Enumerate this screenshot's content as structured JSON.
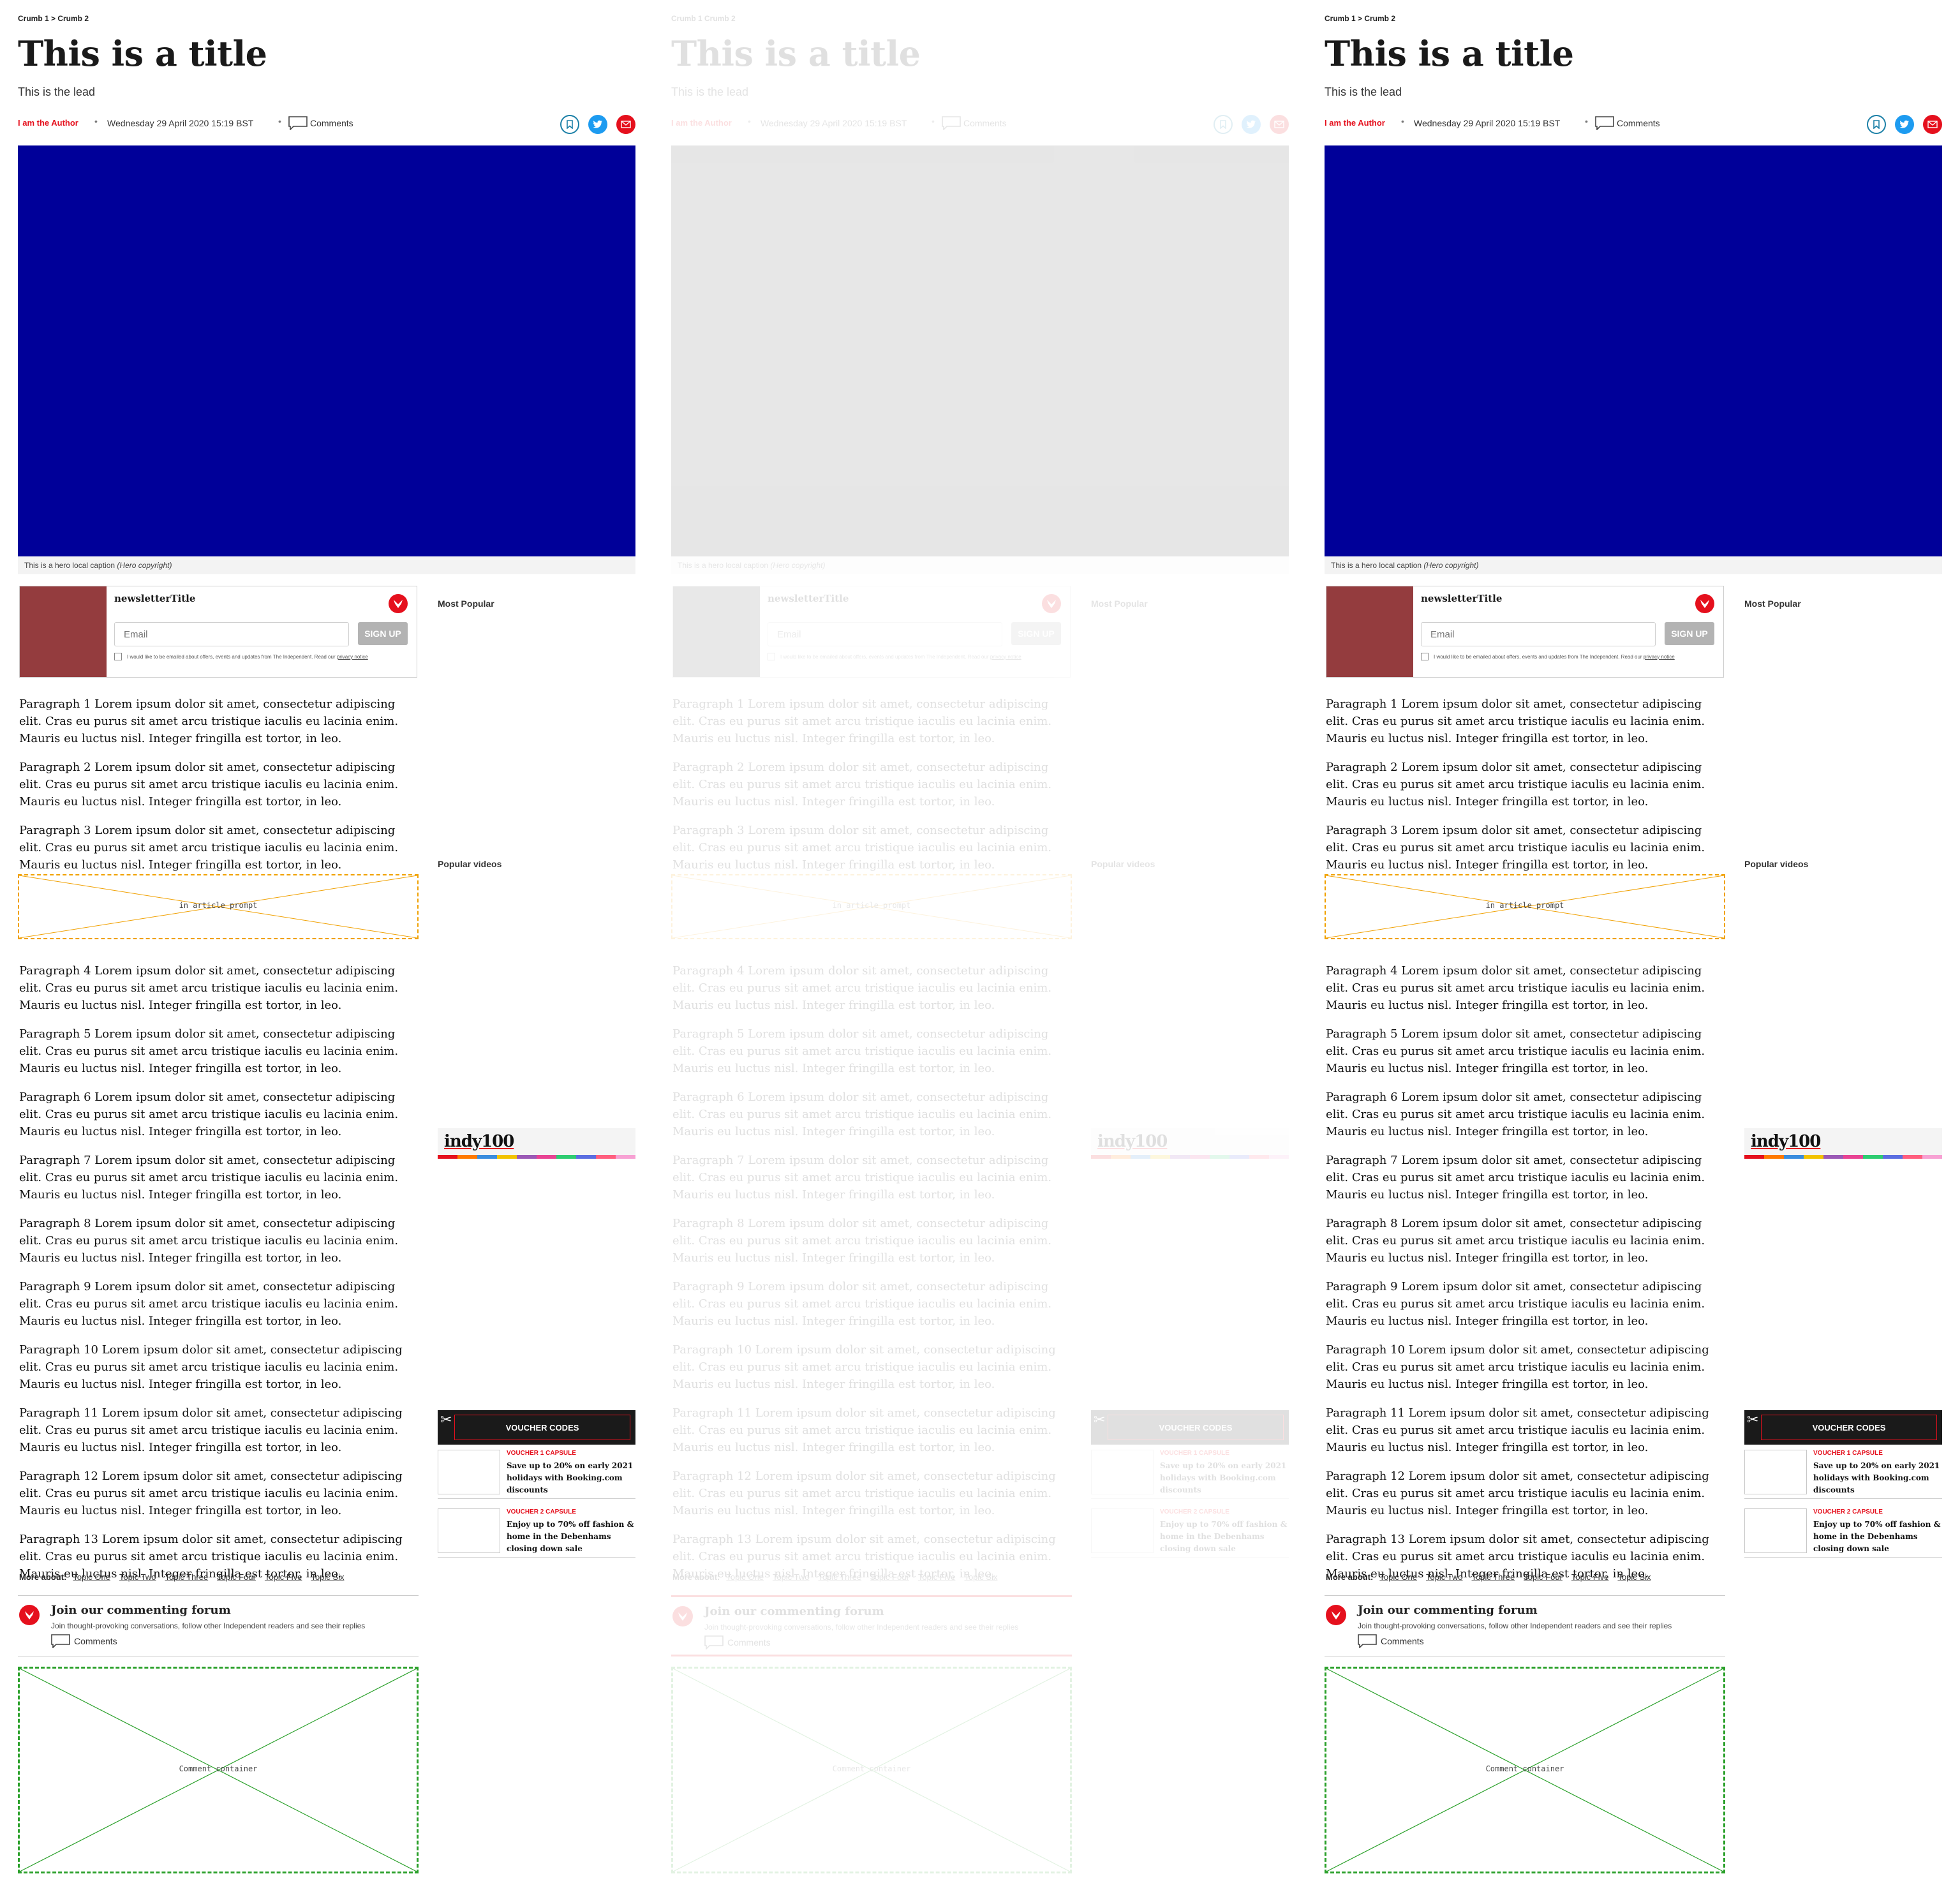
{
  "article": {
    "breadcrumb": "Crumb 1 > Crumb 2",
    "breadcrumb_alt": "Crumb 1 Crumb 2",
    "title": "This is a title",
    "lead": "This is the lead",
    "author": "I am the Author",
    "date": "Wednesday 29 April 2020 15:19 BST",
    "comments_label": "Comments",
    "share_icons": [
      "bookmark-icon",
      "twitter-icon",
      "email-icon"
    ],
    "hero_color": "#000099",
    "caption": "This is a hero local caption",
    "caption_copyright": "(Hero copyright)"
  },
  "newsletter": {
    "title": "newsletterTitle",
    "email_placeholder": "Email",
    "signup_label": "SIGN UP",
    "consent_text": "I would like to be emailed about offers, events and updates from The Independent. Read our",
    "privacy_link": "privacy notice"
  },
  "paragraphs": [
    "Paragraph 1 Lorem ipsum dolor sit amet, consectetur adipiscing elit. Cras eu purus sit amet arcu tristique iaculis eu lacinia enim. Mauris eu luctus nisl. Integer fringilla est tortor, in leo.",
    "Paragraph 2 Lorem ipsum dolor sit amet, consectetur adipiscing elit. Cras eu purus sit amet arcu tristique iaculis eu lacinia enim. Mauris eu luctus nisl. Integer fringilla est tortor, in leo.",
    "Paragraph 3 Lorem ipsum dolor sit amet, consectetur adipiscing elit. Cras eu purus sit amet arcu tristique iaculis eu lacinia enim. Mauris eu luctus nisl. Integer fringilla est tortor, in leo.",
    "Paragraph 4 Lorem ipsum dolor sit amet, consectetur adipiscing elit. Cras eu purus sit amet arcu tristique iaculis eu lacinia enim. Mauris eu luctus nisl. Integer fringilla est tortor, in leo.",
    "Paragraph 5 Lorem ipsum dolor sit amet, consectetur adipiscing elit. Cras eu purus sit amet arcu tristique iaculis eu lacinia enim. Mauris eu luctus nisl. Integer fringilla est tortor, in leo.",
    "Paragraph 6 Lorem ipsum dolor sit amet, consectetur adipiscing elit. Cras eu purus sit amet arcu tristique iaculis eu lacinia enim. Mauris eu luctus nisl. Integer fringilla est tortor, in leo.",
    "Paragraph 7 Lorem ipsum dolor sit amet, consectetur adipiscing elit. Cras eu purus sit amet arcu tristique iaculis eu lacinia enim. Mauris eu luctus nisl. Integer fringilla est tortor, in leo.",
    "Paragraph 8 Lorem ipsum dolor sit amet, consectetur adipiscing elit. Cras eu purus sit amet arcu tristique iaculis eu lacinia enim. Mauris eu luctus nisl. Integer fringilla est tortor, in leo.",
    "Paragraph 9 Lorem ipsum dolor sit amet, consectetur adipiscing elit. Cras eu purus sit amet arcu tristique iaculis eu lacinia enim. Mauris eu luctus nisl. Integer fringilla est tortor, in leo.",
    "Paragraph 10 Lorem ipsum dolor sit amet, consectetur adipiscing elit. Cras eu purus sit amet arcu tristique iaculis eu lacinia enim. Mauris eu luctus nisl. Integer fringilla est tortor, in leo.",
    "Paragraph 11 Lorem ipsum dolor sit amet, consectetur adipiscing elit. Cras eu purus sit amet arcu tristique iaculis eu lacinia enim. Mauris eu luctus nisl. Integer fringilla est tortor, in leo.",
    "Paragraph 12 Lorem ipsum dolor sit amet, consectetur adipiscing elit. Cras eu purus sit amet arcu tristique iaculis eu lacinia enim. Mauris eu luctus nisl. Integer fringilla est tortor, in leo.",
    "Paragraph 13 Lorem ipsum dolor sit amet, consectetur adipiscing elit. Cras eu purus sit amet arcu tristique iaculis eu lacinia enim. Mauris eu luctus nisl. Integer fringilla est tortor, in leo."
  ],
  "in_article_prompt": "in article prompt",
  "more_about": {
    "label": "More about:",
    "topics": [
      "Topic One",
      "Topic Two",
      "Topic Three",
      "Topic Four",
      "Topic Five",
      "Topic Six"
    ]
  },
  "forum": {
    "title": "Join our commenting forum",
    "subtitle": "Join thought-provoking conversations, follow other Independent readers and see their replies",
    "comments_label": "Comments"
  },
  "comment_container": "Comment container",
  "sidebar": {
    "most_popular": "Most Popular",
    "popular_videos": "Popular videos",
    "indy_logo": "indy100",
    "indy_stripe_colors": [
      "#e5101d",
      "#ff7a00",
      "#3a8dde",
      "#f2c300",
      "#9b59b6",
      "#e84393",
      "#2ecc71",
      "#5b6ee1",
      "#ff5e7e",
      "#f7a1d3"
    ],
    "voucher_title": "VOUCHER CODES",
    "vouchers": [
      {
        "label": "VOUCHER 1 CAPSULE",
        "text": "Save up to 20% on early 2021 holidays with Booking.com discounts"
      },
      {
        "label": "VOUCHER 2 CAPSULE",
        "text": "Enjoy up to 70% off fashion & home in the Debenhams closing down sale"
      }
    ]
  },
  "colors": {
    "accent_red": "#e5101d",
    "twitter_blue": "#1d9bf0",
    "bookmark_teal": "#1a7fa6",
    "prompt_border": "#f0a000",
    "comment_border": "#2aa02a",
    "newsletter_thumb": "#943c3e"
  }
}
